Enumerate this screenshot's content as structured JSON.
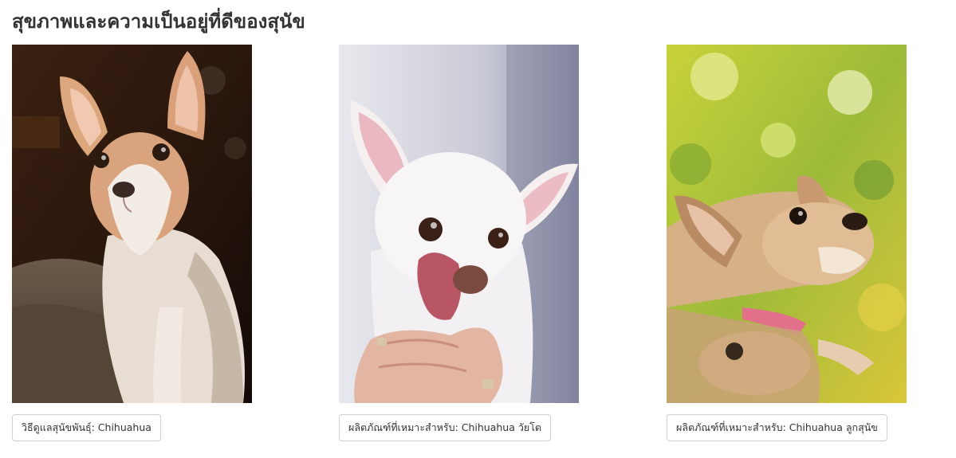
{
  "section": {
    "title": "สุขภาพและความเป็นอยู่ที่ดีของสุนัข"
  },
  "cards": [
    {
      "image": "photo-chihuahua-tan-white-dark-background",
      "tag": "วิธีดูแลสุนัขพันธุ์: Chihuahua"
    },
    {
      "image": "photo-white-chihuahua-licking-nose-held-in-hand",
      "tag": "ผลิตภัณฑ์ที่เหมาะสำหรับ: Chihuahua วัยโต"
    },
    {
      "image": "photo-chihuahua-puppy-reflection-green-bokeh",
      "tag": "ผลิตภัณฑ์ที่เหมาะสำหรับ: Chihuahua ลูกสุนัข"
    }
  ]
}
